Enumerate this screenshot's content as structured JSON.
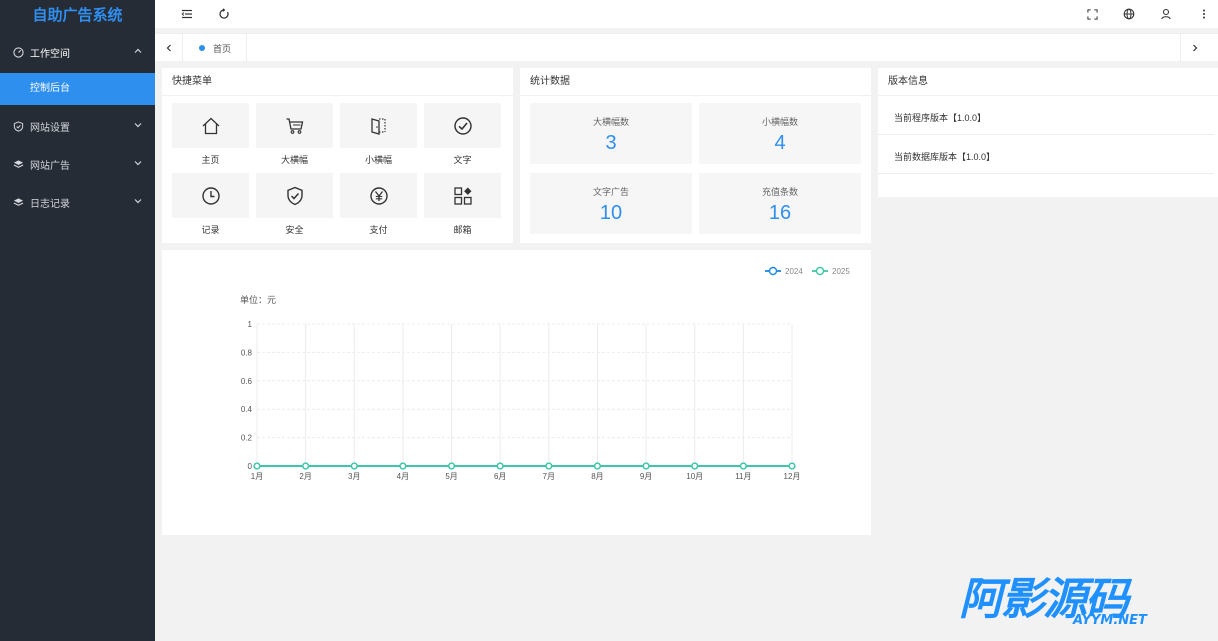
{
  "app": {
    "title": "自助广告系统"
  },
  "sidebar": {
    "items": [
      {
        "label": "工作空间",
        "icon": "dashboard-icon",
        "children": [
          {
            "label": "控制后台"
          }
        ]
      },
      {
        "label": "网站设置",
        "icon": "shield-check-icon"
      },
      {
        "label": "网站广告",
        "icon": "layers-icon"
      },
      {
        "label": "日志记录",
        "icon": "layers-icon"
      }
    ]
  },
  "tabs": {
    "items": [
      {
        "label": "首页"
      }
    ]
  },
  "quick_menu": {
    "title": "快捷菜单",
    "items": [
      {
        "label": "主页",
        "icon": "home-icon"
      },
      {
        "label": "大横幅",
        "icon": "cart-icon"
      },
      {
        "label": "小横幅",
        "icon": "door-icon"
      },
      {
        "label": "文字",
        "icon": "check-circle-icon"
      },
      {
        "label": "记录",
        "icon": "clock-icon"
      },
      {
        "label": "安全",
        "icon": "shield-check-icon"
      },
      {
        "label": "支付",
        "icon": "yen-circle-icon"
      },
      {
        "label": "邮箱",
        "icon": "grid-diamond-icon"
      }
    ]
  },
  "stats": {
    "title": "统计数据",
    "items": [
      {
        "label": "大横幅数",
        "value": "3"
      },
      {
        "label": "小横幅数",
        "value": "4"
      },
      {
        "label": "文字广告",
        "value": "10"
      },
      {
        "label": "充值条数",
        "value": "16"
      }
    ]
  },
  "version": {
    "title": "版本信息",
    "program": "当前程序版本【1.0.0】",
    "database": "当前数据库版本【1.0.0】"
  },
  "chart_data": {
    "type": "line",
    "ylabel": "单位：元",
    "categories": [
      "1月",
      "2月",
      "3月",
      "4月",
      "5月",
      "6月",
      "7月",
      "8月",
      "9月",
      "10月",
      "11月",
      "12月"
    ],
    "ylim": [
      0,
      1
    ],
    "yticks": [
      "0",
      "0.2",
      "0.4",
      "0.6",
      "0.8",
      "1"
    ],
    "legend_position": "top-right",
    "grid": true,
    "series": [
      {
        "name": "2024",
        "color": "#1e88e5",
        "values": [
          0,
          0,
          0,
          0,
          0,
          0,
          0,
          0,
          0,
          0,
          0,
          0
        ]
      },
      {
        "name": "2025",
        "color": "#3dc9a6",
        "values": [
          0,
          0,
          0,
          0,
          0,
          0,
          0,
          0,
          0,
          0,
          0,
          0
        ]
      }
    ]
  },
  "watermark": {
    "text_cn": "阿影源码",
    "text_en": "AYYM.NET"
  }
}
